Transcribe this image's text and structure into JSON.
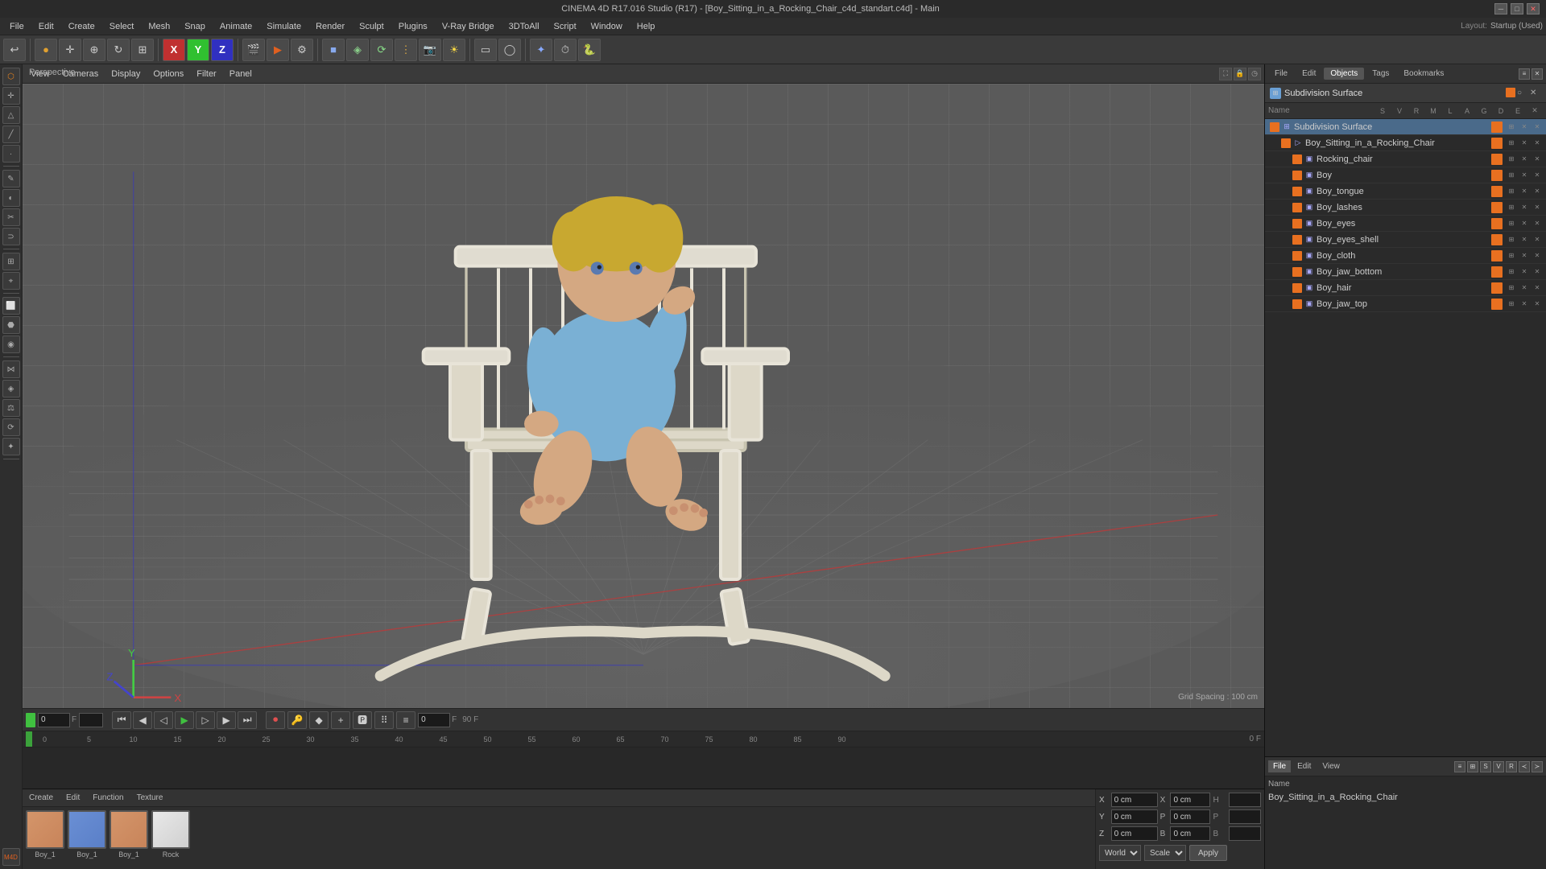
{
  "window": {
    "title": "CINEMA 4D R17.016 Studio (R17) - [Boy_Sitting_in_a_Rocking_Chair_c4d_standart.c4d] - Main"
  },
  "menu": {
    "items": [
      "File",
      "Edit",
      "Create",
      "Select",
      "Mesh",
      "Snap",
      "Animate",
      "Simulate",
      "Render",
      "Sculpt",
      "Plugins",
      "V-Ray Bridge",
      "3DToAll",
      "Script",
      "Window",
      "Help"
    ]
  },
  "layout": {
    "label": "Layout:",
    "value": "Startup (Used)"
  },
  "right_panel": {
    "tabs": [
      "File",
      "Edit",
      "Objects",
      "Tags",
      "Bookmarks"
    ],
    "subdivision_label": "Subdivision Surface",
    "tree_columns": [
      "Name",
      "S",
      "V",
      "R",
      "M",
      "L",
      "A",
      "G",
      "D",
      "E",
      "X"
    ],
    "tree_items": [
      {
        "name": "Subdivision Surface",
        "level": 0,
        "type": "subdiv",
        "color": "#e87020"
      },
      {
        "name": "Boy_Sitting_in_a_Rocking_Chair",
        "level": 1,
        "type": "group",
        "color": "#e87020"
      },
      {
        "name": "Rocking_chair",
        "level": 2,
        "type": "mesh",
        "color": "#e87020"
      },
      {
        "name": "Boy",
        "level": 2,
        "type": "mesh",
        "color": "#e87020"
      },
      {
        "name": "Boy_tongue",
        "level": 2,
        "type": "mesh",
        "color": "#e87020"
      },
      {
        "name": "Boy_lashes",
        "level": 2,
        "type": "mesh",
        "color": "#e87020"
      },
      {
        "name": "Boy_eyes",
        "level": 2,
        "type": "mesh",
        "color": "#e87020"
      },
      {
        "name": "Boy_eyes_shell",
        "level": 2,
        "type": "mesh",
        "color": "#e87020"
      },
      {
        "name": "Boy_cloth",
        "level": 2,
        "type": "mesh",
        "color": "#e87020"
      },
      {
        "name": "Boy_jaw_bottom",
        "level": 2,
        "type": "mesh",
        "color": "#e87020"
      },
      {
        "name": "Boy_hair",
        "level": 2,
        "type": "mesh",
        "color": "#e87020"
      },
      {
        "name": "Boy_jaw_top",
        "level": 2,
        "type": "mesh",
        "color": "#e87020"
      }
    ]
  },
  "bottom_right": {
    "tabs": [
      "File",
      "Edit",
      "View"
    ],
    "name_label": "Name",
    "item_name": "Boy_Sitting_in_a_Rocking_Chair"
  },
  "viewport": {
    "perspective_label": "Perspective",
    "grid_spacing": "Grid Spacing : 100 cm",
    "view_menu_items": [
      "View",
      "Cameras",
      "Display",
      "Options",
      "Filter",
      "Panel"
    ]
  },
  "timeline": {
    "frame_numbers": [
      "0",
      "5",
      "10",
      "15",
      "20",
      "25",
      "30",
      "35",
      "40",
      "45",
      "50",
      "55",
      "60",
      "65",
      "70",
      "75",
      "80",
      "85",
      "90"
    ],
    "current_frame": "0 F",
    "end_frame": "90 F",
    "frame_input": "0",
    "frame_display": "0 F"
  },
  "material_panel": {
    "toolbar": [
      "Create",
      "Edit",
      "Function",
      "Texture"
    ],
    "materials": [
      {
        "label": "Boy_1",
        "type": "skin"
      },
      {
        "label": "Boy_1",
        "type": "blue"
      },
      {
        "label": "Boy_1",
        "type": "skin"
      },
      {
        "label": "Rock",
        "type": "white"
      }
    ]
  },
  "coords": {
    "x": {
      "label": "X",
      "value": "0 cm",
      "label2": "X",
      "value2": "0 cm"
    },
    "y": {
      "label": "Y",
      "value": "0 cm",
      "label2": "P",
      "value2": "0 cm"
    },
    "z": {
      "label": "Z",
      "value": "0 cm",
      "label2": "B",
      "value2": "0 cm"
    },
    "world_label": "World",
    "scale_label": "Scale",
    "apply_label": "Apply"
  }
}
